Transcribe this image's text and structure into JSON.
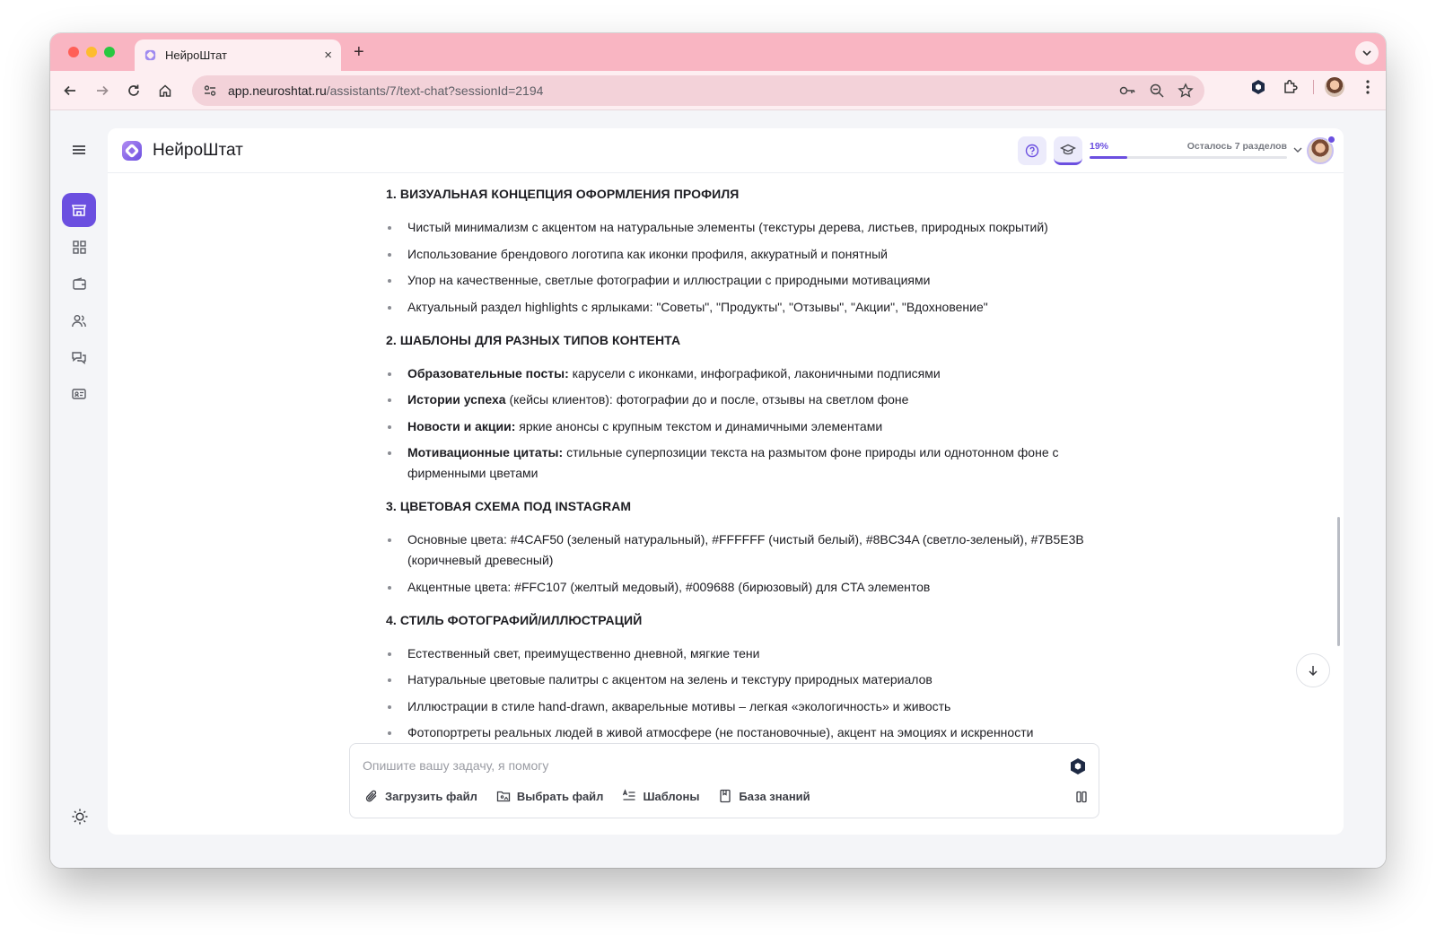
{
  "browser": {
    "tab_title": "НейроШтат",
    "url_host": "app.neuroshtat.ru",
    "url_path": "/assistants/7/text-chat?sessionId=2194"
  },
  "app": {
    "brand": "НейроШтат",
    "progress": {
      "percent_label": "19%",
      "fraction": 0.19,
      "remaining_label": "Осталось 7 разделов"
    },
    "accent_color": "#6b4fe0"
  },
  "chat": {
    "sections": [
      {
        "title": "1. ВИЗУАЛЬНАЯ КОНЦЕПЦИЯ ОФОРМЛЕНИЯ ПРОФИЛЯ",
        "items": [
          {
            "bold": "",
            "text": "Чистый минимализм с акцентом на натуральные элементы (текстуры дерева, листьев, природных покрытий)"
          },
          {
            "bold": "",
            "text": "Использование брендового логотипа как иконки профиля, аккуратный и понятный"
          },
          {
            "bold": "",
            "text": "Упор на качественные, светлые фотографии и иллюстрации с природными мотивациями"
          },
          {
            "bold": "",
            "text": "Актуальный раздел highlights с ярлыками: \"Советы\", \"Продукты\", \"Отзывы\", \"Акции\", \"Вдохновение\""
          }
        ]
      },
      {
        "title": "2. ШАБЛОНЫ ДЛЯ РАЗНЫХ ТИПОВ КОНТЕНТА",
        "items": [
          {
            "bold": "Образовательные посты:",
            "text": " карусели с иконками, инфографикой, лаконичными подписями"
          },
          {
            "bold": "Истории успеха",
            "text": " (кейсы клиентов): фотографии до и после, отзывы на светлом фоне"
          },
          {
            "bold": "Новости и акции:",
            "text": " яркие анонсы с крупным текстом и динамичными элементами"
          },
          {
            "bold": "Мотивационные цитаты:",
            "text": " стильные суперпозиции текста на размытом фоне природы или однотонном фоне с фирменными цветами"
          }
        ]
      },
      {
        "title": "3. ЦВЕТОВАЯ СХЕМА ПОД INSTAGRAM",
        "items": [
          {
            "bold": "",
            "text": "Основные цвета: #4CAF50 (зеленый натуральный), #FFFFFF (чистый белый), #8BC34A (светло-зеленый), #7B5E3B (коричневый древесный)"
          },
          {
            "bold": "",
            "text": "Акцентные цвета: #FFC107 (желтый медовый), #009688 (бирюзовый) для CTA элементов"
          }
        ]
      },
      {
        "title": "4. СТИЛЬ ФОТОГРАФИЙ/ИЛЛЮСТРАЦИЙ",
        "items": [
          {
            "bold": "",
            "text": "Естественный свет, преимущественно дневной, мягкие тени"
          },
          {
            "bold": "",
            "text": "Натуральные цветовые палитры с акцентом на зелень и текстуру природных материалов"
          },
          {
            "bold": "",
            "text": "Иллюстрации в стиле hand-drawn, акварельные мотивы – легкая «экологичность» и живость"
          },
          {
            "bold": "",
            "text": "Фотопортреты реальных людей в живой атмосфере (не постановочные), акцент на эмоциях и искренности"
          }
        ]
      }
    ]
  },
  "composer": {
    "placeholder": "Опишите вашу задачу, я помогу",
    "actions": [
      {
        "label": "Загрузить файл",
        "icon": "paperclip-icon"
      },
      {
        "label": "Выбрать файл",
        "icon": "folder-image-icon"
      },
      {
        "label": "Шаблоны",
        "icon": "templates-icon"
      },
      {
        "label": "База знаний",
        "icon": "book-icon"
      }
    ]
  }
}
